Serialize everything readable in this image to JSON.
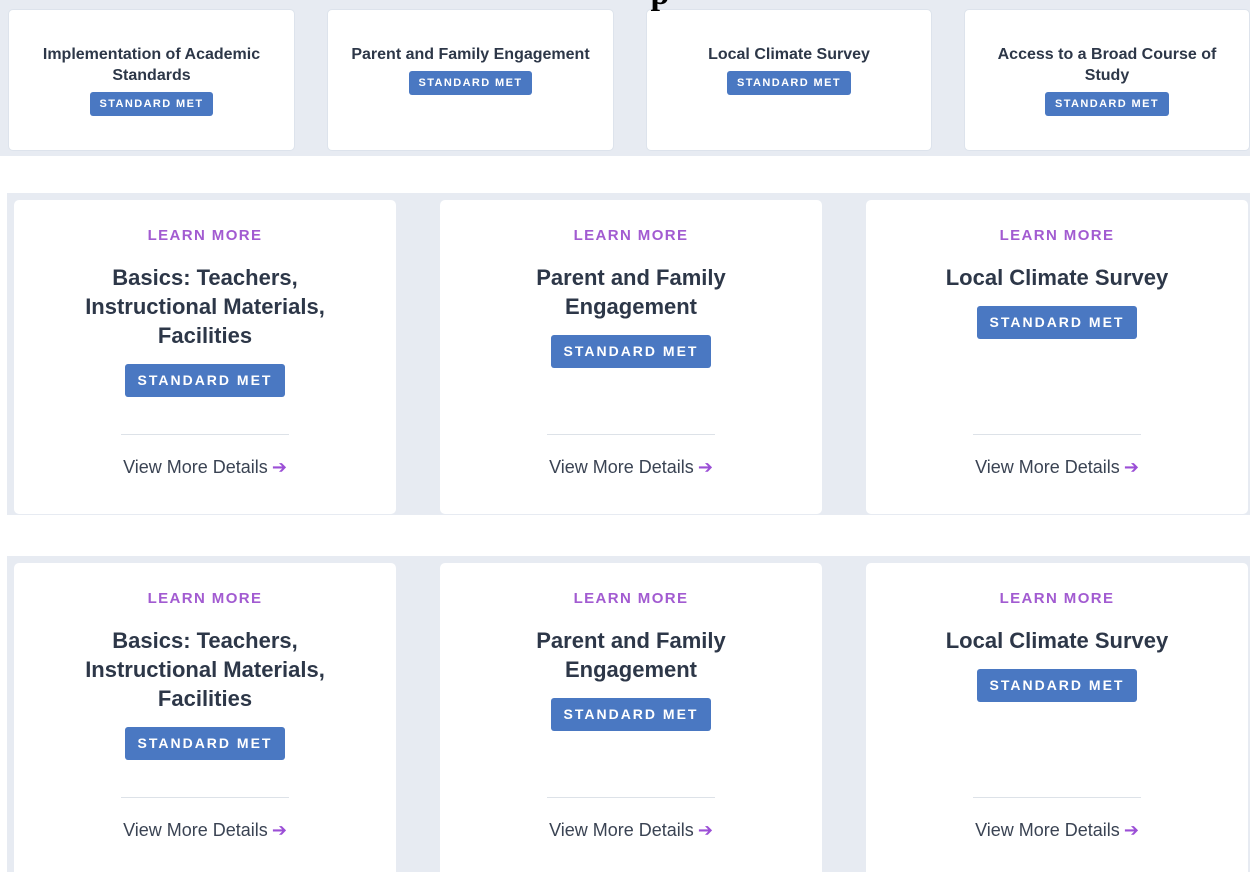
{
  "page": {
    "heading_fragment": "p"
  },
  "summary_cards": [
    {
      "title": "Implementation of Academic Standards",
      "status": "STANDARD MET"
    },
    {
      "title": "Parent and Family Engagement",
      "status": "STANDARD MET"
    },
    {
      "title": "Local Climate Survey",
      "status": "STANDARD MET"
    },
    {
      "title": "Access to a Broad Course of Study",
      "status": "STANDARD MET"
    }
  ],
  "detail_rows": [
    {
      "cards": [
        {
          "eyebrow": "LEARN MORE",
          "title": "Basics: Teachers, Instructional Materials, Facilities",
          "status": "STANDARD MET",
          "link": "View More Details",
          "link_icon": "arrow-right-icon"
        },
        {
          "eyebrow": "LEARN MORE",
          "title": "Parent and Family Engagement",
          "status": "STANDARD MET",
          "link": "View More Details",
          "link_icon": "arrow-right-icon"
        },
        {
          "eyebrow": "LEARN MORE",
          "title": "Local Climate Survey",
          "status": "STANDARD MET",
          "link": "View More Details",
          "link_icon": "arrow-right-icon"
        }
      ]
    },
    {
      "cards": [
        {
          "eyebrow": "LEARN MORE",
          "title": "Basics: Teachers, Instructional Materials, Facilities",
          "status": "STANDARD MET",
          "link": "View More Details",
          "link_icon": "arrow-right-icon"
        },
        {
          "eyebrow": "LEARN MORE",
          "title": "Parent and Family Engagement",
          "status": "STANDARD MET",
          "link": "View More Details",
          "link_icon": "arrow-right-icon"
        },
        {
          "eyebrow": "LEARN MORE",
          "title": "Local Climate Survey",
          "status": "STANDARD MET",
          "link": "View More Details",
          "link_icon": "arrow-right-icon"
        }
      ]
    }
  ],
  "colors": {
    "badge": "#4a78c2",
    "eyebrow": "#a25bd1",
    "arrow": "#9b4fd6",
    "section_background": "#e7ebf2"
  }
}
